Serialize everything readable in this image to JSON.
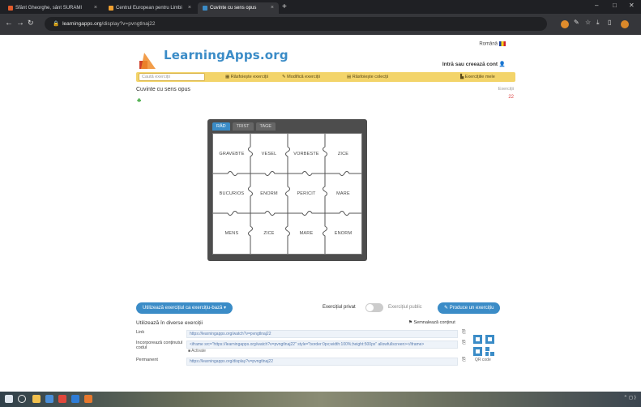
{
  "browser": {
    "tabs": [
      {
        "label": "Sfânt Gheorghe, sânt SURAMI",
        "active": false,
        "fav_color": "#e15b2c"
      },
      {
        "label": "Centrul European pentru Limbi",
        "active": false,
        "fav_color": "#f0a030"
      },
      {
        "label": "Cuvinte cu sens opus",
        "active": true,
        "fav_color": "#3b8cc7"
      }
    ],
    "new_tab": "+",
    "address": {
      "host": "learningapps.org",
      "path": "/display?v=pvngtlnaj22"
    },
    "window_controls": [
      "–",
      "□",
      "✕"
    ]
  },
  "header": {
    "logo_text": "LearningApps.org",
    "language": "Română",
    "login": "Intră sau creează cont"
  },
  "nav": {
    "search_placeholder": "Caută exerciții",
    "items": [
      "Răsfoiește exerciții",
      "Modifică exerciții",
      "Răsfoiește colecții",
      "Exercițiile mele"
    ]
  },
  "page": {
    "title": "Cuvinte cu sens opus",
    "subtitle": "Exerciții",
    "count": "22"
  },
  "app": {
    "tabs": [
      "RÂD",
      "TRIST",
      "TAGE"
    ],
    "words": [
      "GRAVEBTE",
      "VESEL",
      "VORBESTE",
      "ZICE",
      "BUCURIOS",
      "ENORM",
      "PERICIT",
      "MARE",
      "MENS",
      "ZICE",
      "MARE",
      "ENORM"
    ]
  },
  "bottom": {
    "share_button": "Utilizează exercițiul ca exercițiu-bază",
    "private_label": "Exercițiul privat",
    "public_label": "Exercițiul public",
    "create_button": "Produce un exercițiu",
    "share_title": "Utilizează în diverse exerciții",
    "mark_favorite": "Semnalează conținut",
    "links": [
      {
        "label": "Link",
        "value": "https://learningapps.org/watch?v=pvngtlnaj22"
      },
      {
        "label": "Incorporează conținutul codul",
        "value": "<iframe src=\"https://learningapps.org/watch?v=pvngtlnaj22\" style=\"border:0px;width:100%;height:500px\" allowfullscreen></iframe>"
      },
      {
        "label": "Permanent",
        "value": "https://learningapps.org/display?v=pvngtlnaj22"
      }
    ],
    "activate": "Activate",
    "qr_label": "QR code"
  },
  "colors": {
    "accent": "#3b8cc7",
    "navbar": "#f3d46a",
    "app_frame": "#4d4d4d"
  }
}
